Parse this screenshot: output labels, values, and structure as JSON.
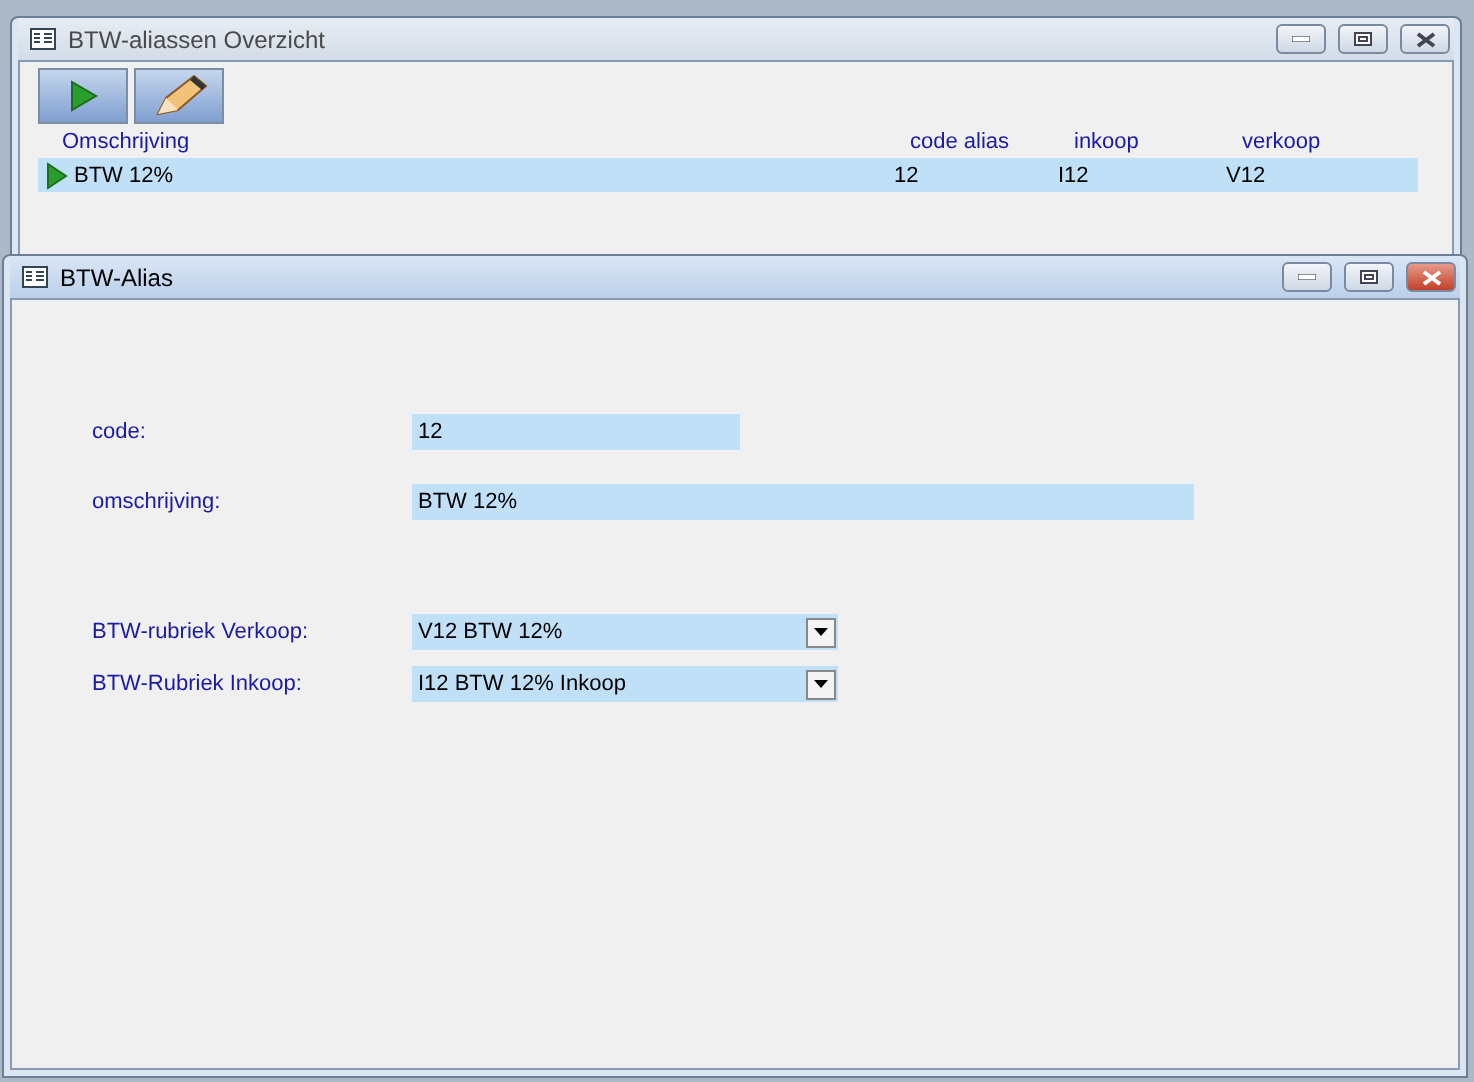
{
  "windows": [
    {
      "kind": "list",
      "title": "BTW-aliassen Overzicht",
      "active": false,
      "table": {
        "columns": [
          "Omschrijving",
          "code alias",
          "inkoop",
          "verkoop"
        ],
        "rows": [
          {
            "cells": [
              "BTW 12%",
              "12",
              "I12",
              "V12"
            ],
            "selected": true
          }
        ]
      }
    },
    {
      "kind": "form",
      "title": "BTW-Alias",
      "active": true,
      "fields": [
        {
          "kind": "text",
          "label": "code:",
          "value": "12",
          "wide": false
        },
        {
          "kind": "text",
          "label": "omschrijving:",
          "value": "BTW 12%",
          "wide": true
        },
        {
          "kind": "dropdown",
          "label": "BTW-rubriek Verkoop:",
          "value": "V12 BTW 12%"
        },
        {
          "kind": "dropdown",
          "label": "BTW-Rubriek Inkoop:",
          "value": "I12 BTW 12% Inkoop"
        }
      ]
    }
  ]
}
